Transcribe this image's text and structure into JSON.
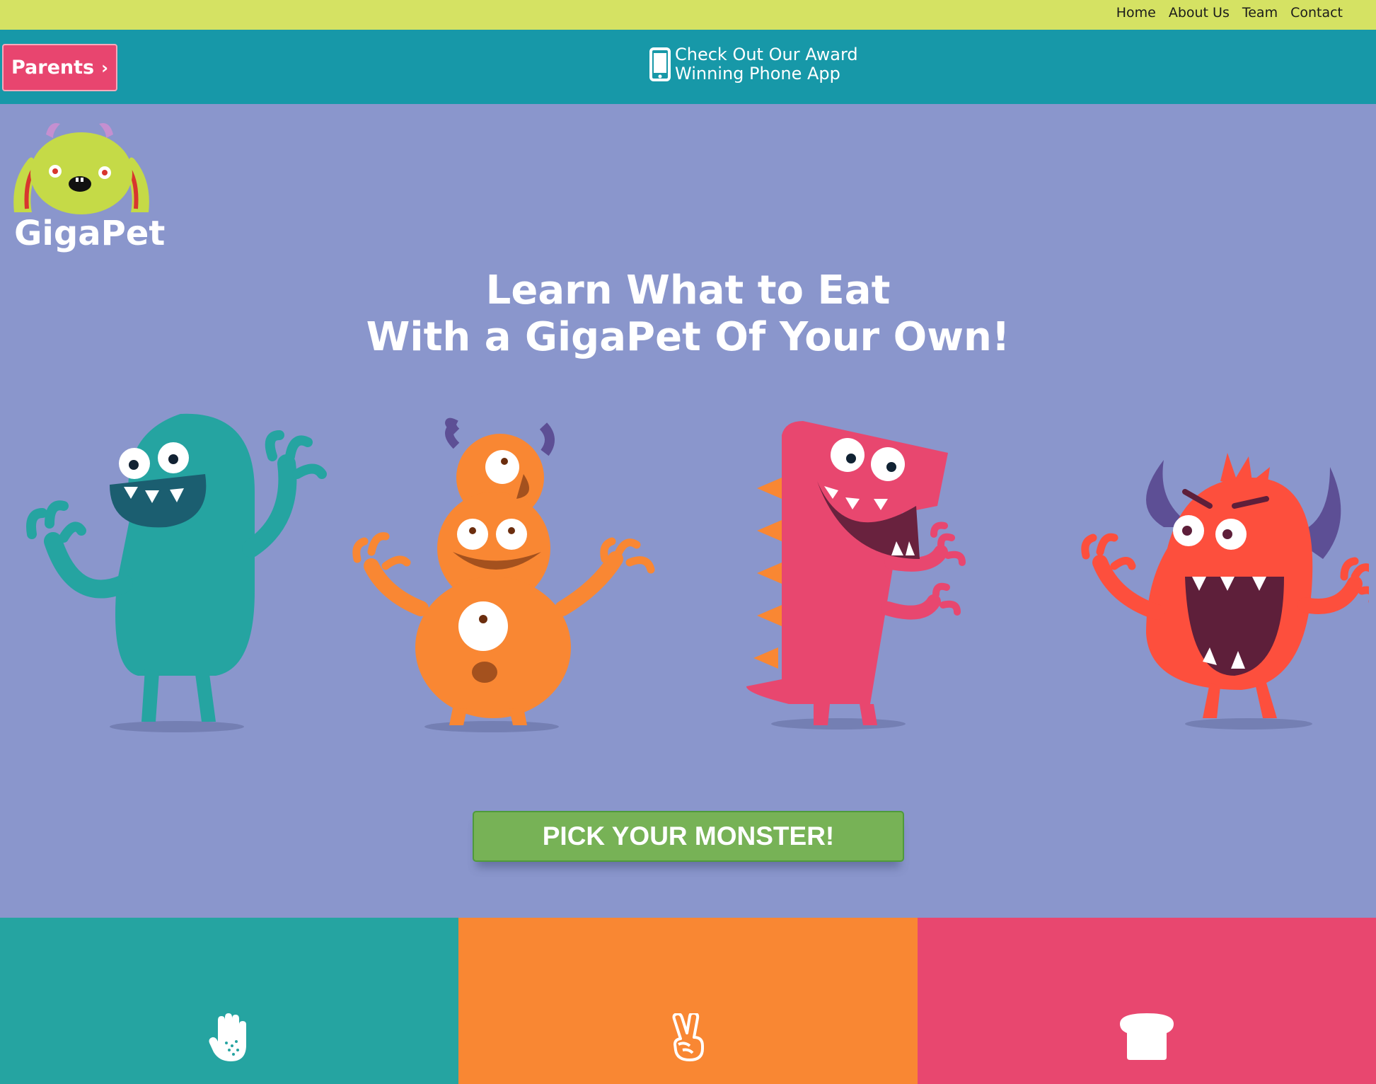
{
  "nav": {
    "items": [
      {
        "label": "Home"
      },
      {
        "label": "About Us"
      },
      {
        "label": "Team"
      },
      {
        "label": "Contact"
      }
    ]
  },
  "appbar": {
    "parents_label": "Parents",
    "parents_icon": "chevron-right-icon",
    "promo_line1": "Check Out Our Award",
    "promo_line2": "Winning Phone App",
    "promo_icon": "mobile-phone-icon"
  },
  "logo": {
    "text": "GigaPet"
  },
  "hero": {
    "line1": "Learn What to Eat",
    "line2": "With a GigaPet Of Your Own!"
  },
  "monsters": [
    {
      "name": "teal-monster",
      "color": "#25a4a1"
    },
    {
      "name": "orange-monster",
      "color": "#f98733"
    },
    {
      "name": "pink-monster",
      "color": "#e8476f"
    },
    {
      "name": "red-monster",
      "color": "#fd4f3d"
    }
  ],
  "cta": {
    "label": "PICK YOUR MONSTER!"
  },
  "features": [
    {
      "color": "#25a4a1",
      "icon": "hand-wash-icon"
    },
    {
      "color": "#f98733",
      "icon": "peace-hand-icon"
    },
    {
      "color": "#e8476f",
      "icon": "bread-icon"
    }
  ],
  "colors": {
    "topnav": "#d5e263",
    "appbar": "#1798a8",
    "hero_bg": "#8a96cc",
    "parents_btn": "#e8456f",
    "cta": "#77b256"
  }
}
